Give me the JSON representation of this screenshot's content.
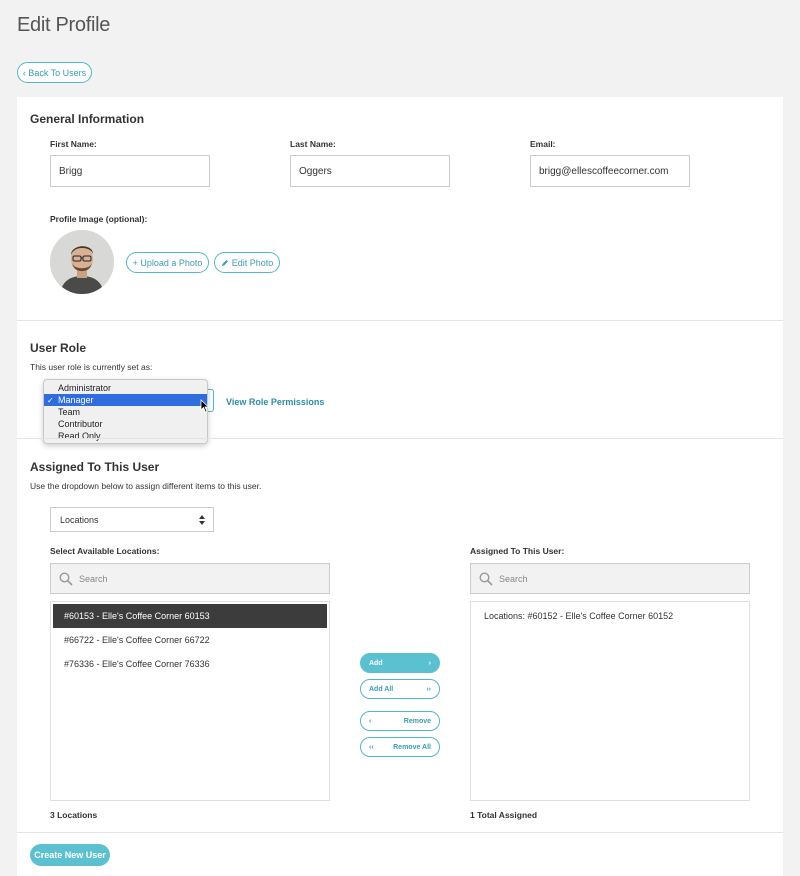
{
  "page": {
    "title": "Edit Profile",
    "back_label": "‹ Back To Users"
  },
  "general": {
    "title": "General Information",
    "first_name": {
      "label": "First Name:",
      "value": "Brigg"
    },
    "last_name": {
      "label": "Last Name:",
      "value": "Oggers"
    },
    "email": {
      "label": "Email:",
      "value": "brigg@ellescoffeecorner.com"
    },
    "profile_image_label": "Profile Image (optional):",
    "upload_label": "+ Upload a Photo",
    "edit_label": "Edit Photo"
  },
  "role": {
    "title": "User Role",
    "description": "This user role is currently set as:",
    "options": [
      "Administrator",
      "Manager",
      "Team",
      "Contributor",
      "Read Only"
    ],
    "selected": "Manager",
    "permissions_link": "View Role Permissions"
  },
  "assigned": {
    "title": "Assigned To This User",
    "description": "Use the dropdown below to assign different items to this user.",
    "type_select": "Locations",
    "available_label": "Select Available Locations:",
    "assigned_label": "Assigned To This User:",
    "search_placeholder": "Search",
    "available_items": [
      "#60153 - Elle's Coffee Corner 60153",
      "#66722 - Elle's Coffee Corner 66722",
      "#76336 - Elle's Coffee Corner 76336"
    ],
    "assigned_items": [
      "Locations: #60152 - Elle's Coffee Corner 60152"
    ],
    "available_count": "3 Locations",
    "assigned_count": "1 Total Assigned",
    "buttons": {
      "add": "Add",
      "add_all": "Add All",
      "remove": "Remove",
      "remove_all": "Remove All"
    }
  },
  "footer": {
    "create_label": "Create New User"
  },
  "colors": {
    "accent": "#5bc0d0",
    "link": "#2b8ea3",
    "selection": "#2f6ce0"
  }
}
